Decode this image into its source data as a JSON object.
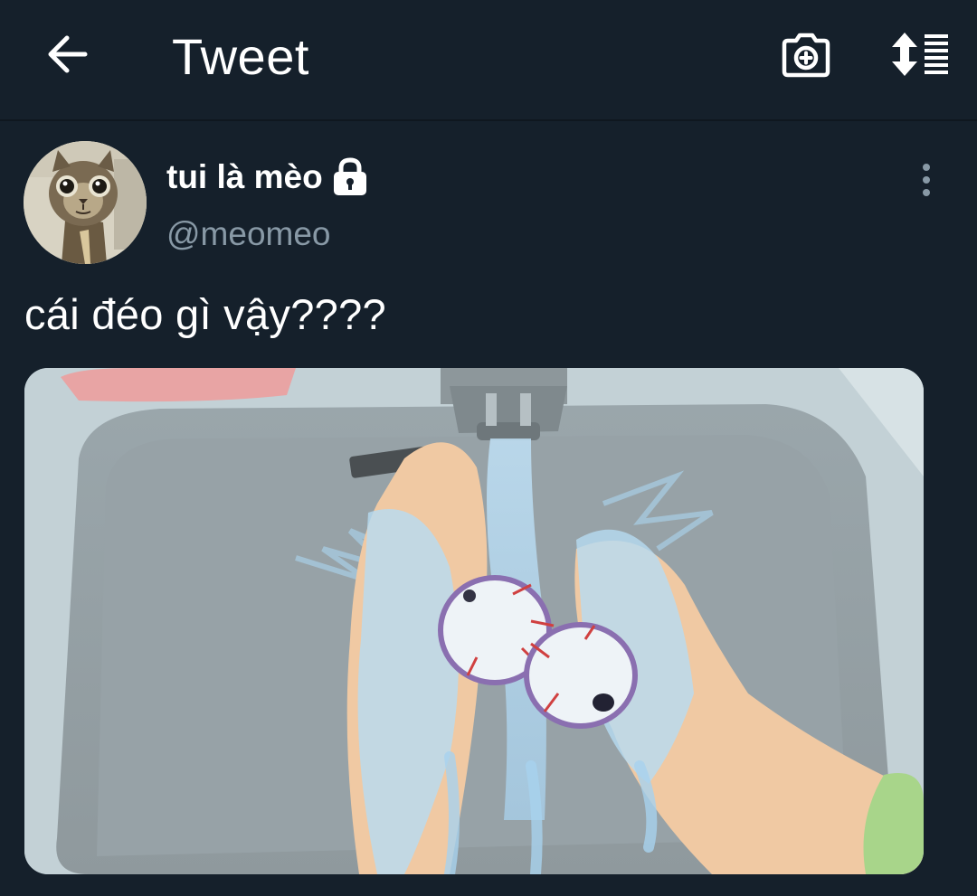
{
  "header": {
    "title": "Tweet",
    "back_icon": "arrow-left-icon",
    "camera_icon": "camera-add-icon",
    "sort_icon": "sort-list-icon"
  },
  "tweet": {
    "display_name": "tui là mèo",
    "protected_icon": "lock-icon",
    "handle": "@meomeo",
    "text": "cái đéo gì vậy????",
    "more_icon": "more-vertical-icon",
    "avatar_description_icon": "cat-avatar"
  },
  "colors": {
    "background": "#15202b",
    "text_primary": "#ffffff",
    "text_secondary": "#8899a6"
  }
}
